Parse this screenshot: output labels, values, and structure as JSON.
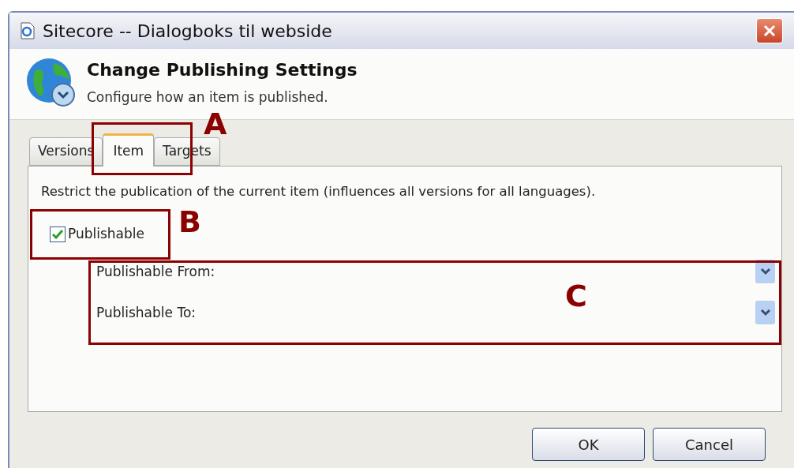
{
  "window": {
    "title": "Sitecore -- Dialogboks til webside"
  },
  "header": {
    "title": "Change Publishing Settings",
    "subtitle": "Configure how an item is published."
  },
  "tabs": [
    {
      "label": "Versions",
      "selected": false
    },
    {
      "label": "Item",
      "selected": true
    },
    {
      "label": "Targets",
      "selected": false
    }
  ],
  "panel": {
    "description": "Restrict the publication of the current item (influences all versions for all languages).",
    "publishable": {
      "label": "Publishable",
      "checked": true
    },
    "fields": [
      {
        "label": "Publishable From:"
      },
      {
        "label": "Publishable To:"
      }
    ]
  },
  "buttons": [
    "OK",
    "Cancel"
  ],
  "annotations": [
    {
      "letter": "A",
      "kind": "tab"
    },
    {
      "letter": "B",
      "kind": "checkbox"
    },
    {
      "letter": "C",
      "kind": "fields"
    }
  ]
}
